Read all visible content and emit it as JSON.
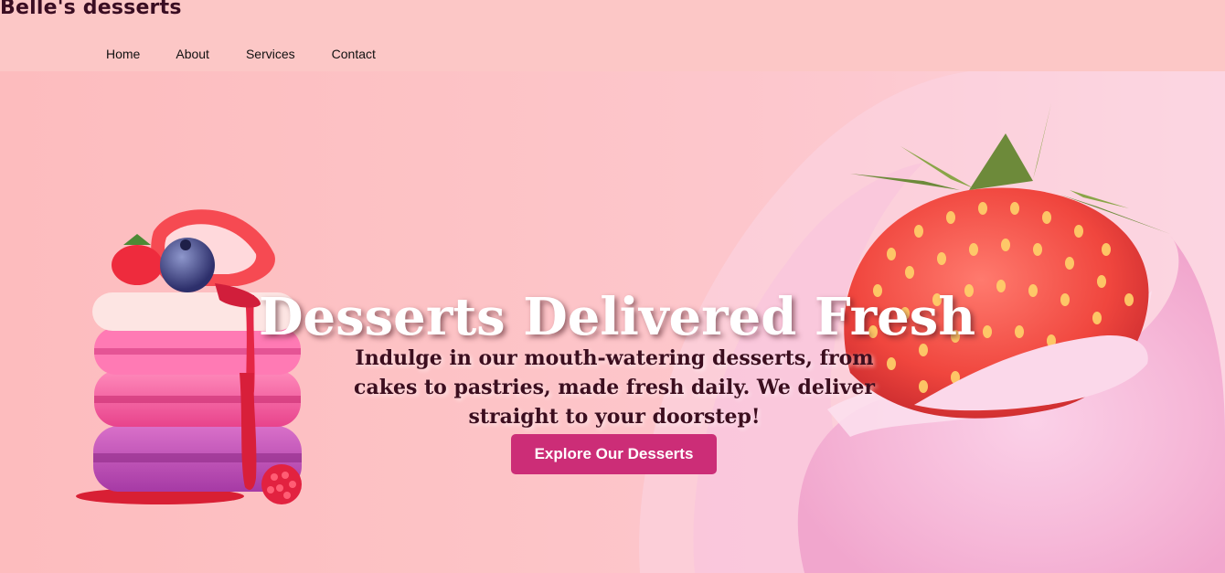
{
  "header": {
    "brand": "Belle's desserts",
    "nav": [
      {
        "label": "Home"
      },
      {
        "label": "About"
      },
      {
        "label": "Services"
      },
      {
        "label": "Contact"
      }
    ]
  },
  "hero": {
    "headline": "Desserts Delivered Fresh",
    "subtext": "Indulge in our mouth-watering desserts, from cakes to pastries, made fresh daily. We deliver straight to your doorstep!",
    "cta_label": "Explore Our Desserts",
    "images": [
      "macaron-stack-image",
      "strawberry-milk-splash-image"
    ]
  },
  "colors": {
    "header_bg": "#fcc7c6",
    "hero_bg": "#fdc3c6",
    "cta_bg": "#cc2d77",
    "brand_text": "#3a0d22",
    "subtext": "#3c0e1f"
  }
}
